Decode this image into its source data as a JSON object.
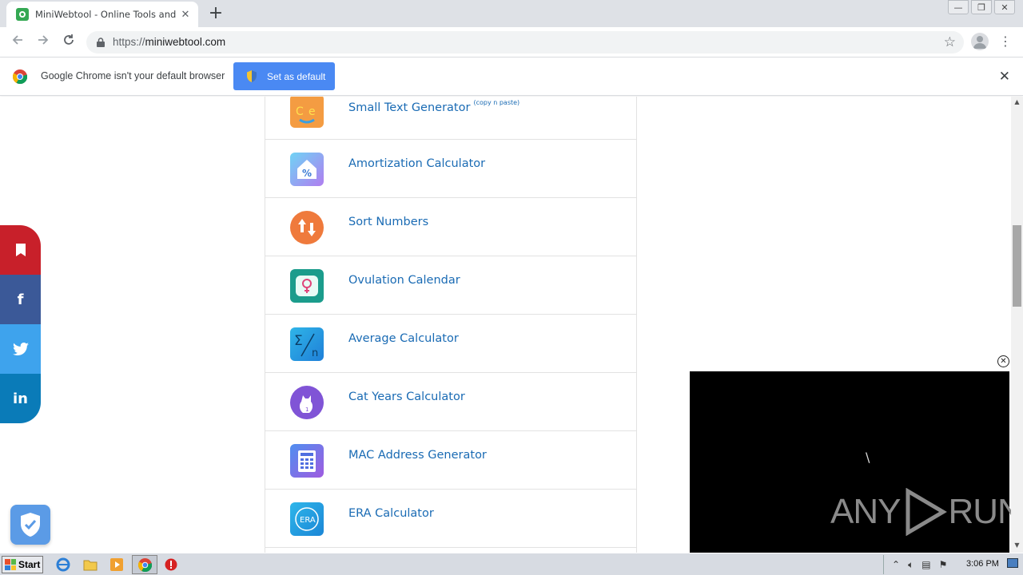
{
  "browser": {
    "tab_title": "MiniWebtool - Online Tools and Calcu",
    "tab_close": "✕",
    "new_tab": "+",
    "url_protocol": "https://",
    "url_host": "miniwebtool.com",
    "window_controls": [
      "—",
      "❐",
      "✕"
    ]
  },
  "infobar": {
    "message": "Google Chrome isn't your default browser",
    "button_label": "Set as default",
    "close": "✕"
  },
  "tools": [
    {
      "label": "Small Text Generator",
      "sup": "(copy n paste)",
      "icon": "small-text-icon"
    },
    {
      "label": "Amortization Calculator",
      "sup": "",
      "icon": "house-percent-icon"
    },
    {
      "label": "Sort Numbers",
      "sup": "",
      "icon": "sort-arrows-icon"
    },
    {
      "label": "Ovulation Calendar",
      "sup": "",
      "icon": "female-symbol-icon"
    },
    {
      "label": "Average Calculator",
      "sup": "",
      "icon": "sigma-icon"
    },
    {
      "label": "Cat Years Calculator",
      "sup": "",
      "icon": "cat-icon"
    },
    {
      "label": "MAC Address Generator",
      "sup": "",
      "icon": "mac-icon"
    },
    {
      "label": "ERA Calculator",
      "sup": "",
      "icon": "baseball-icon"
    }
  ],
  "share": {
    "bookmark": "bookmark-icon",
    "facebook": "f",
    "twitter": "twitter-icon",
    "linkedin": "in"
  },
  "overlay": {
    "close": "✕",
    "loader": "\\",
    "watermark_left": "ANY",
    "watermark_right": "RUN"
  },
  "taskbar": {
    "start": "Start",
    "clock": "3:06 PM"
  },
  "colors": {
    "link": "#1a6bb4",
    "bookmark": "#c8202a",
    "facebook": "#3b5998",
    "twitter": "#3ea3ed",
    "linkedin": "#0a7bb8",
    "set_default_button": "#4a89f3"
  }
}
